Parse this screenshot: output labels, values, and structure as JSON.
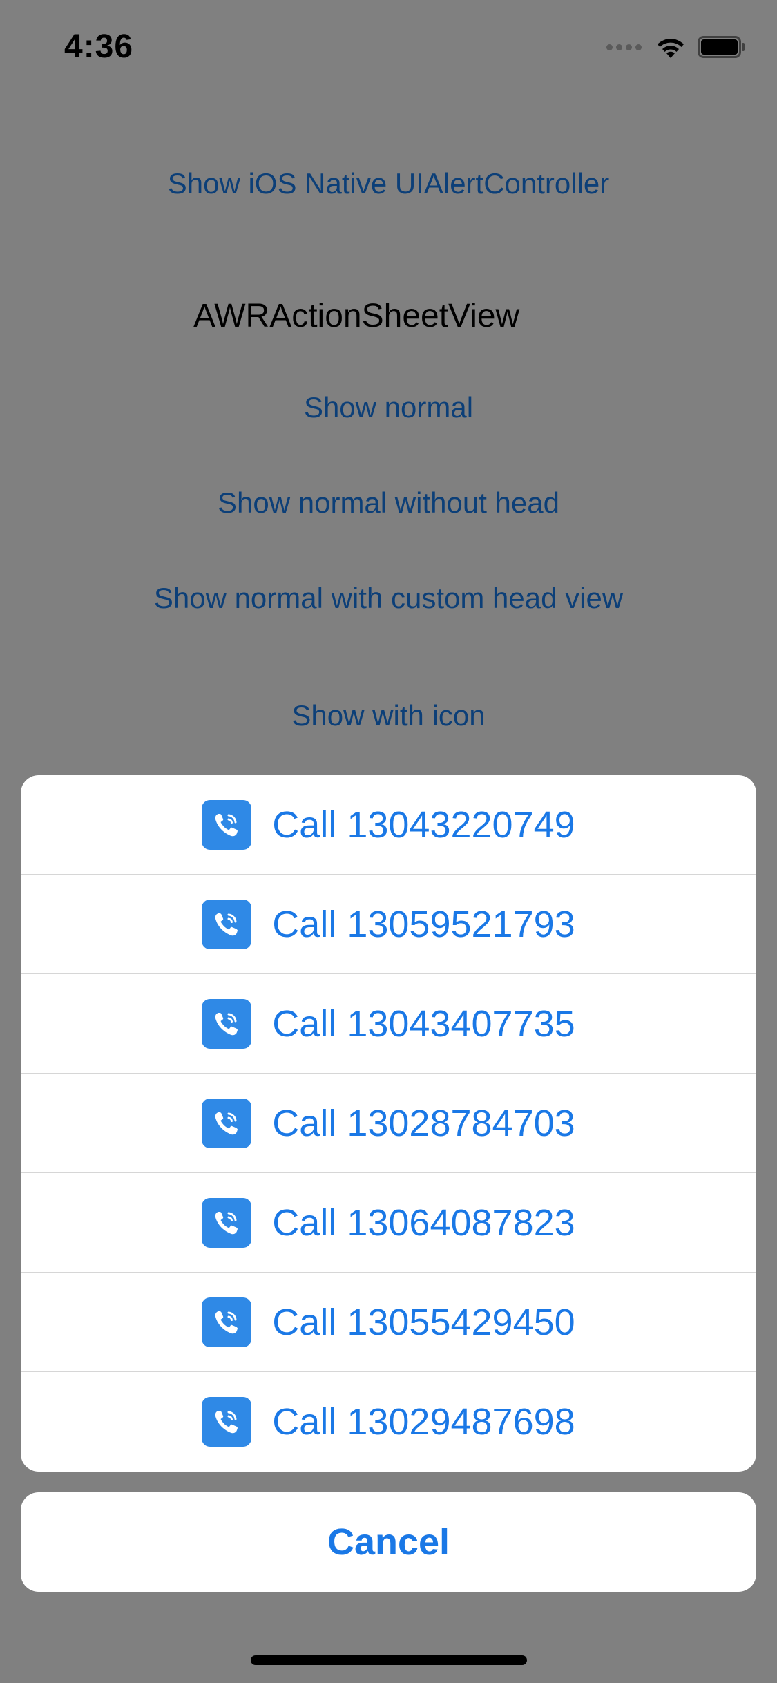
{
  "status_bar": {
    "time": "4:36"
  },
  "background": {
    "native_link": "Show iOS Native UIAlertController",
    "section_title": "AWRActionSheetView",
    "links": [
      "Show normal",
      "Show normal without head",
      "Show normal with custom head view",
      "Show with icon"
    ]
  },
  "action_sheet": {
    "items": [
      {
        "label": "Call 13043220749",
        "icon": "phone-icon"
      },
      {
        "label": "Call 13059521793",
        "icon": "phone-icon"
      },
      {
        "label": "Call 13043407735",
        "icon": "phone-icon"
      },
      {
        "label": "Call 13028784703",
        "icon": "phone-icon"
      },
      {
        "label": "Call 13064087823",
        "icon": "phone-icon"
      },
      {
        "label": "Call 13055429450",
        "icon": "phone-icon"
      },
      {
        "label": "Call 13029487698",
        "icon": "phone-icon"
      }
    ],
    "cancel_label": "Cancel"
  },
  "colors": {
    "dim_background": "#808080",
    "accent": "#1a78e6",
    "icon_bg": "#2f89e6",
    "dimmed_link": "#0c3f78"
  }
}
